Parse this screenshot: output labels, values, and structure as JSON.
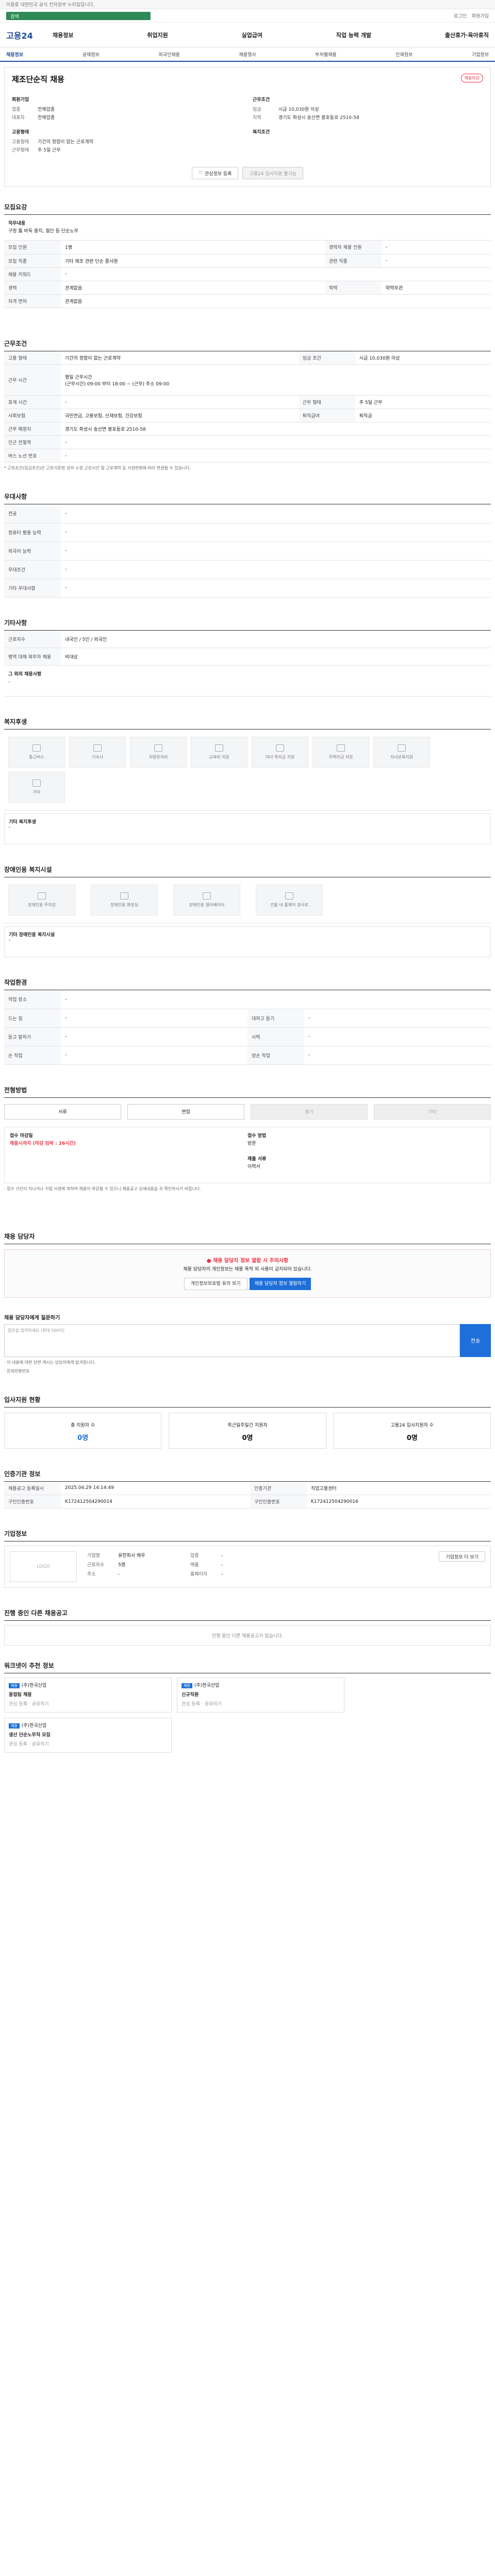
{
  "topbar": {
    "text": "이용중 대한민국 공식 전자정부 누리집입니다.",
    "link": ""
  },
  "search": {
    "box": "검색"
  },
  "util": [
    "로그인",
    "회원가입"
  ],
  "logo": "고용24",
  "gnb": [
    "채용정보",
    "취업지원",
    "실업급여",
    "직업 능력 개발",
    "출산휴가·육아휴직"
  ],
  "subnav": [
    "채용정보",
    "공채정보",
    "외국인채용",
    "채용행사",
    "부처별채용",
    "인재정보",
    "기업정보"
  ],
  "job": {
    "title": "제조단순직 채용",
    "badge": "채용마감",
    "company_h": "회원기업",
    "company_rows": [
      [
        "업종",
        "전체업종"
      ],
      [
        "대표자",
        "전체업종"
      ]
    ],
    "cond_h": "근무조건",
    "cond_rows": [
      [
        "임금",
        "시급 10,030원 이상"
      ],
      [
        "지역",
        "경기도 화성시 송산면 봉호동로 2510-58"
      ]
    ],
    "emp_h": "고용형태",
    "emp_rows": [
      [
        "고용형태",
        "기간의 정함이 없는 근로계약"
      ],
      [
        "근무형태",
        "주 5일 근무"
      ]
    ],
    "benefit_h": "복지조건",
    "btn1": "관심정보 등록",
    "btn2": "고용24 입사지원 불가능"
  },
  "s1": {
    "h": "모집요강",
    "duty_h": "직무내용",
    "duty": "구멍 뚫 바둑 용지, 절단 등 단순노무",
    "rows": [
      [
        "모집 인원",
        "1명",
        "경력자 채용 인원",
        "-"
      ],
      [
        "모집 직종",
        "기타 제조 관련 단순 종사원",
        "관련 직종",
        "-"
      ],
      [
        "채용 키워드",
        "-",
        "",
        ""
      ],
      [
        "경력",
        "관계없음",
        "학력",
        "학력무관"
      ],
      [
        "자격 면허",
        "관계없음",
        "",
        ""
      ]
    ]
  },
  "s2": {
    "h": "근무조건",
    "rows": [
      [
        "고용 형태",
        "기간의 정함이 없는 근로계약",
        "임금 조건",
        "시급 10,030원 이상"
      ],
      [
        "근무 시간",
        "평일 근무시간\n(근무시간) 09:00 부터 18:00 ~ (근무) 주소 09:00",
        "",
        ""
      ],
      [
        "휴게 시간",
        "-",
        "근무 형태",
        "주 5일 근무"
      ],
      [
        "사회보험",
        "국민연금, 고용보험, 산재보험, 건강보험",
        "퇴직급여",
        "퇴직금"
      ],
      [
        "근무 예정지",
        "경기도 화성시 송산면 봉호동로 2510-58",
        "",
        ""
      ],
      [
        "인근 전철역",
        "-",
        "",
        ""
      ],
      [
        "버스 노선 번호",
        "-",
        "",
        ""
      ]
    ],
    "note": "* 근로조건(임금조건)은 근로기준법 상의 소정 근로시간 및 근로계약 등 사정변화에 따라 변경될 수 있습니다."
  },
  "s3": {
    "h": "우대사항",
    "rows": [
      [
        "전공",
        "-"
      ],
      [
        "컴퓨터 활용 능력",
        "-"
      ],
      [
        "외국어 능력",
        "-"
      ],
      [
        "우대조건",
        "-"
      ],
      [
        "기타 우대사항",
        "-"
      ]
    ]
  },
  "s4": {
    "h": "기타사항",
    "rows": [
      [
        "근로자수",
        "내국인 / 5인 / 외국인"
      ],
      [
        "병역 대체 복무자 채용",
        "비대상"
      ]
    ],
    "extra_h": "그 외의 채용사항",
    "extra": "-"
  },
  "s5": {
    "h": "복지후생",
    "items": [
      "통근버스",
      "기숙사",
      "차량유지비",
      "교육비 지원",
      "자녀 학자금 지원",
      "주택자금 지원",
      "자녀보육지원",
      "기타"
    ],
    "note_h": "기타 복지후생",
    "note": "-"
  },
  "s6": {
    "h": "장애인용 복지시설",
    "items": [
      "장애인용 주차장",
      "장애인용 화장실",
      "장애인용 엘리베이터",
      "건물 내 휠체어 경사로"
    ],
    "note_h": "기타 장애인용 복지시설",
    "note": "-"
  },
  "s7": {
    "h": "작업환경",
    "rows": [
      [
        "작업 장소",
        "-",
        "",
        ""
      ],
      [
        "드는 힘",
        "-",
        "대하고 듣기",
        "-"
      ],
      [
        "듣고 말하기",
        "-",
        "시력",
        "-"
      ],
      [
        "손 작업",
        "-",
        "양손 작업",
        "-"
      ]
    ]
  },
  "s8": {
    "h": "전형방법",
    "opts": [
      "서류",
      "면접",
      "필기",
      "기타"
    ],
    "proc": {
      "a": "접수 마감일",
      "b": "채용시까지 (마감 임박 : 26시간)",
      "c": "접수 방법",
      "d": "방문",
      "e": "제출 서류",
      "f": "이력서"
    },
    "note": "· 접수 기간이 지나거나 기업 사정에 의하여 채용이 마감될 수 있으니 채용공고 상세내용을 꼭 확인하시기 바랍니다."
  },
  "s9": {
    "h": "채용 담당자",
    "warn": "채용 담당자 정보 열람 시 주의사항",
    "warn2": "채용 담당자의 개인정보는 채용 목적 외 사용이 금지되어 있습니다.",
    "btn1": "개인정보보호법 유의 보기",
    "btn2": "채용 담당자 정보 열람하기"
  },
  "s10": {
    "h": "채용 담당자에게 질문하기",
    "hint": "질문을 입력하세요 (최대 500자)",
    "go": "전송",
    "note1": "· 이 내용에 대한 답변 게시는 담당자에게 맡겨집니다.",
    "note2": "· 문의전화번호"
  },
  "s11": {
    "h": "입사지원 현황",
    "cards": [
      [
        "총 지원자 수",
        "0명"
      ],
      [
        "최근일주일간 지원자",
        "0명"
      ],
      [
        "고용24 입사지원자 수",
        "0명"
      ]
    ]
  },
  "s12": {
    "h": "인증기관 정보",
    "rows": [
      [
        "채용공고 등록일시",
        "2025.04.29 14:14:49",
        "인증기관",
        "직업고용센터"
      ],
      [
        "구인인증번호",
        "K172412504290014",
        "구인인증번호",
        "K172412504290016"
      ]
    ]
  },
  "s13": {
    "h": "기업정보",
    "logo": "LOGO",
    "rows": [
      [
        "기업명",
        "유한회사 해우",
        "업종",
        "-"
      ],
      [
        "근로자수",
        "5명",
        "매출",
        "-"
      ],
      [
        "주소",
        "-",
        "홈페이지",
        "-"
      ]
    ],
    "btn": "기업정보 더 보기"
  },
  "s14": {
    "h": "진행 중인 다른 채용공고",
    "empty": "진행 중인 다른 채용공고가 없습니다."
  },
  "s15": {
    "h": "워크넷이 추천 정보",
    "cards": [
      [
        "(주)한국산업",
        "용접팀 채용"
      ],
      [
        "(주)한국산업",
        "신규직원"
      ],
      [
        "(주)한국산업",
        "생산 단순노무직 모집"
      ]
    ],
    "links": "관심 등록 · 공유하기"
  }
}
